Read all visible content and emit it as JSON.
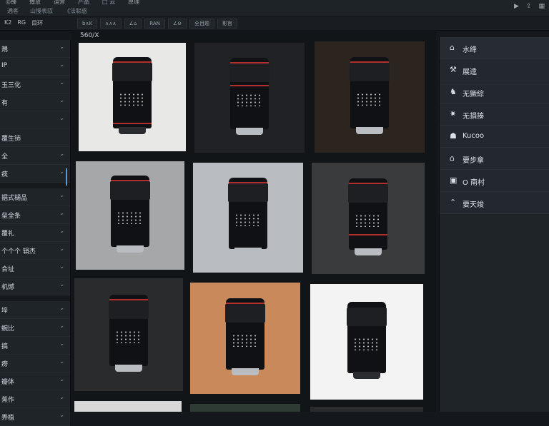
{
  "topbar": {
    "menu": [
      "◎臻",
      "播放",
      "运营",
      "产品",
      "□ 云",
      "原理"
    ],
    "sub": [
      "通客",
      "山慢表驭",
      "《法聪惑"
    ],
    "right_icons": [
      "play-icon",
      "upload-icon",
      "grid-icon"
    ]
  },
  "toolbar": {
    "left": [
      "K2",
      "RG",
      "目环"
    ],
    "tools": [
      "b∧K",
      "∧∧∧",
      "∠⌂",
      "RAN",
      "∠⊖",
      "全目题",
      "影官"
    ]
  },
  "main": {
    "path": "560/X",
    "tiles": [
      {
        "bg": "#e8e8e6"
      },
      {
        "bg": "#202225"
      },
      {
        "bg": "#2b241f"
      },
      {
        "bg": "#a5a7a9"
      },
      {
        "bg": "#b9bcc0"
      },
      {
        "bg": "#3a3b3d"
      },
      {
        "bg": "#2a2b2d"
      },
      {
        "bg": "#c9895a"
      },
      {
        "bg": "#f3f3f3"
      }
    ]
  },
  "sidebar": {
    "items": [
      {
        "label": "鴂"
      },
      {
        "label": "IP"
      },
      {
        "label": "玉三化"
      },
      {
        "label": "有"
      },
      {
        "label": ""
      },
      {
        "label": "覆生铈"
      },
      {
        "label": "全"
      },
      {
        "label": "痰"
      },
      {
        "label": "据式樋品"
      },
      {
        "label": "垒全条"
      },
      {
        "label": "覆礼"
      },
      {
        "label": "个个个 辑杰"
      },
      {
        "label": "合址"
      },
      {
        "label": "机憾"
      },
      {
        "label": "垶"
      },
      {
        "label": "蜿比"
      },
      {
        "label": "搞"
      },
      {
        "label": "痨"
      },
      {
        "label": "瓣体"
      },
      {
        "label": "蒸作"
      },
      {
        "label": "弄植"
      }
    ]
  },
  "right_panel": {
    "items": [
      {
        "icon": "⌂",
        "icon_name": "home-icon",
        "label": "水绛"
      },
      {
        "icon": "⚒",
        "icon_name": "tools-icon",
        "label": "展逵"
      },
      {
        "icon": "♞",
        "icon_name": "figure-icon",
        "label": "无獗綜"
      },
      {
        "icon": "✷",
        "icon_name": "star-icon",
        "label": "无損揍"
      },
      {
        "icon": "☗",
        "icon_name": "cloud-icon",
        "label": "Kucoo"
      },
      {
        "icon": "⌂",
        "icon_name": "house-icon",
        "label": "要步拿"
      },
      {
        "icon": "▣",
        "icon_name": "box-icon",
        "label": "O 南村"
      },
      {
        "icon": "⌃",
        "icon_name": "up-icon",
        "label": "要天竣"
      }
    ]
  }
}
